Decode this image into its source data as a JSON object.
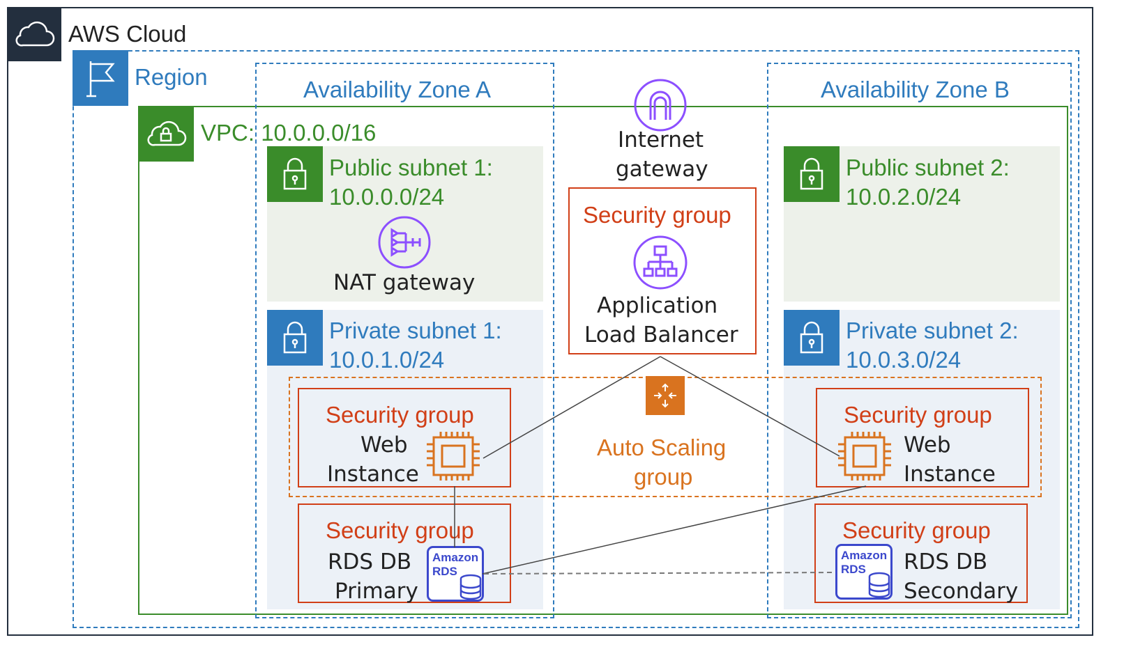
{
  "cloud": {
    "label": "AWS Cloud",
    "icon": "cloud-icon"
  },
  "region": {
    "label": "Region",
    "icon": "flag-icon"
  },
  "vpc": {
    "label": "VPC: 10.0.0.0/16",
    "icon": "vpc-cloud-lock-icon"
  },
  "zones": {
    "a": "Availability Zone A",
    "b": "Availability Zone B"
  },
  "subnets": {
    "public1": {
      "line1": "Public subnet 1:",
      "line2": "10.0.0.0/24"
    },
    "public2": {
      "line1": "Public subnet 2:",
      "line2": "10.0.2.0/24"
    },
    "private1": {
      "line1": "Private subnet 1:",
      "line2": "10.0.1.0/24"
    },
    "private2": {
      "line1": "Private subnet 2:",
      "line2": "10.0.3.0/24"
    }
  },
  "internet_gateway": {
    "line1": "Internet",
    "line2": "gateway"
  },
  "nat_gateway": {
    "label": "NAT gateway"
  },
  "alb": {
    "sg": "Security group",
    "line1": "Application",
    "line2": "Load Balancer"
  },
  "auto_scaling": {
    "line1": "Auto Scaling",
    "line2": "group"
  },
  "web_a": {
    "sg": "Security group",
    "line1": "Web",
    "line2": "Instance"
  },
  "web_b": {
    "sg": "Security group",
    "line1": "Web",
    "line2": "Instance"
  },
  "db_a": {
    "sg": "Security group",
    "line1": "RDS DB",
    "line2": "Primary"
  },
  "db_b": {
    "sg": "Security group",
    "line1": "RDS DB",
    "line2": "Secondary"
  },
  "rds_badge": {
    "line1": "Amazon",
    "line2": "RDS"
  },
  "colors": {
    "blue": "#2f7bbd",
    "green": "#3a8c2a",
    "security_red": "#d13f17",
    "orange": "#d9731f",
    "purple": "#8c4fff",
    "cloud_dark": "#232f3e",
    "public_fill": "#edf1ea",
    "private_fill": "#ecf1f7"
  }
}
